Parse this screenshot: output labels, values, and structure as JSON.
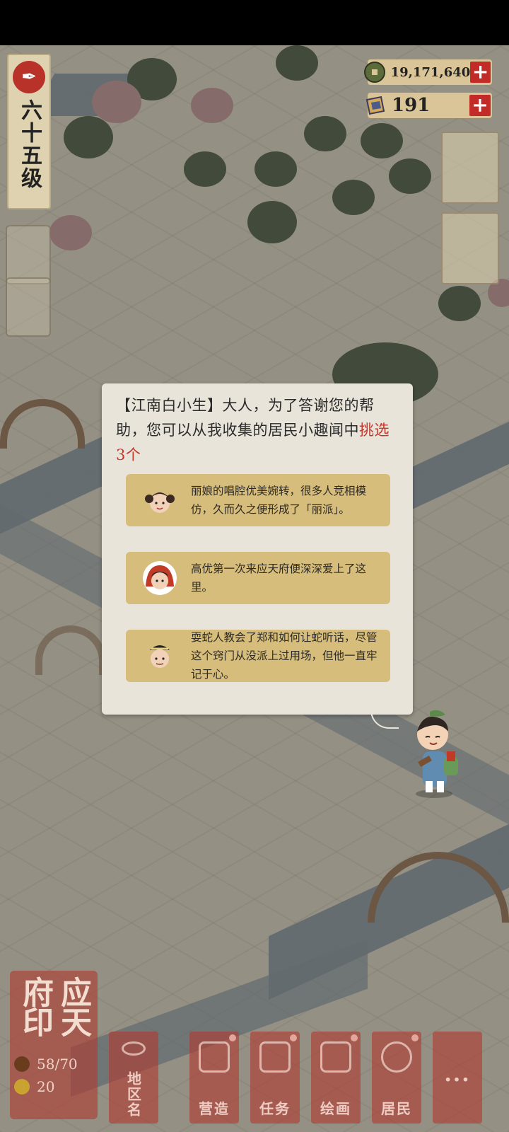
{
  "level": {
    "text": "六十五级"
  },
  "currencies": {
    "coins": {
      "value": "19,171,640",
      "plus": "+"
    },
    "tickets": {
      "value": "191",
      "plus": "+"
    }
  },
  "dialog": {
    "speaker": "【江南白小生】",
    "text_main": "大人，为了答谢您的帮助，您可以从我收集的居民小趣闻中",
    "text_highlight": "挑选3个",
    "rumors": [
      {
        "text": "丽娘的唱腔优美婉转，很多人竞相模仿，久而久之便形成了「丽派」。"
      },
      {
        "text": "高优第一次来应天府便深深爱上了这里。"
      },
      {
        "text": "耍蛇人教会了郑和如何让蛇听话，尽管这个窍门从没派上过用场，但他一直牢记于心。"
      }
    ]
  },
  "seal": {
    "title": "应天府印",
    "pop": "58/70",
    "stat2": "20"
  },
  "bottom_nav": {
    "district": "地区名",
    "build": "营造",
    "tasks": "任务",
    "paint": "绘画",
    "residents": "居民",
    "more": "···"
  },
  "colors": {
    "accent_red": "#c32b28",
    "dialog_bg": "#e9e4da",
    "rumor_bg": "#d7bd7b",
    "highlight": "#c3382c"
  }
}
